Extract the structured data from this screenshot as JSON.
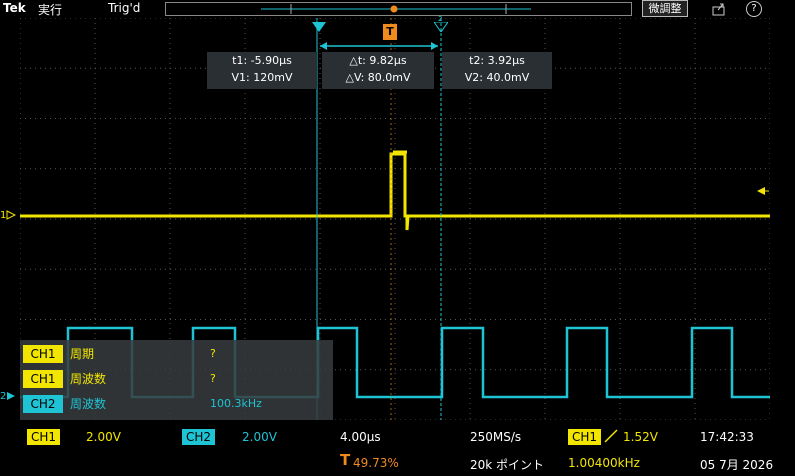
{
  "topbar": {
    "logo": "Tek",
    "run_state": "実行",
    "trigger_state": "Trig'd",
    "fine_label": "微調整",
    "export_icon": "export-icon",
    "help_icon": "help-icon",
    "help_glyph": "?"
  },
  "cursors": {
    "t1_label": "t1: -5.90µs",
    "v1_label": "V1: 120mV",
    "dt_label": "△t: 9.82µs",
    "dv_label": "△V: 80.0mV",
    "t2_label": "t2: 3.92µs",
    "v2_label": "V2: 40.0mV",
    "c1_marker": "1",
    "c2_marker": "2"
  },
  "markers": {
    "ch1_ref": "1",
    "ch2_ref": "2",
    "trigger_marker": "T"
  },
  "measurements": [
    {
      "channel": "CH1",
      "label": "周期",
      "value": "?",
      "color": "#f2e600"
    },
    {
      "channel": "CH1",
      "label": "周波数",
      "value": "?",
      "color": "#f2e600"
    },
    {
      "channel": "CH2",
      "label": "周波数",
      "value": "100.3kHz",
      "color": "#1ec4d4"
    }
  ],
  "status": {
    "ch1_tag": "CH1",
    "ch1_scale": "2.00V",
    "ch2_tag": "CH2",
    "ch2_scale": "2.00V",
    "timebase": "4.00µs",
    "sample_rate": "250MS/s",
    "trig_ch_tag": "CH1",
    "trig_level": "1.52V",
    "time": "17:42:33",
    "trig_pos_glyph": "T",
    "trig_pos": "49.73%",
    "record_length": "20k ポイント",
    "trig_freq": "1.00400kHz",
    "date": "05 7月 2026"
  },
  "colors": {
    "ch1": "#f2e600",
    "ch2": "#1ec4d4",
    "trigger": "#f08a1c",
    "cursor_box": "#2a2f33"
  }
}
